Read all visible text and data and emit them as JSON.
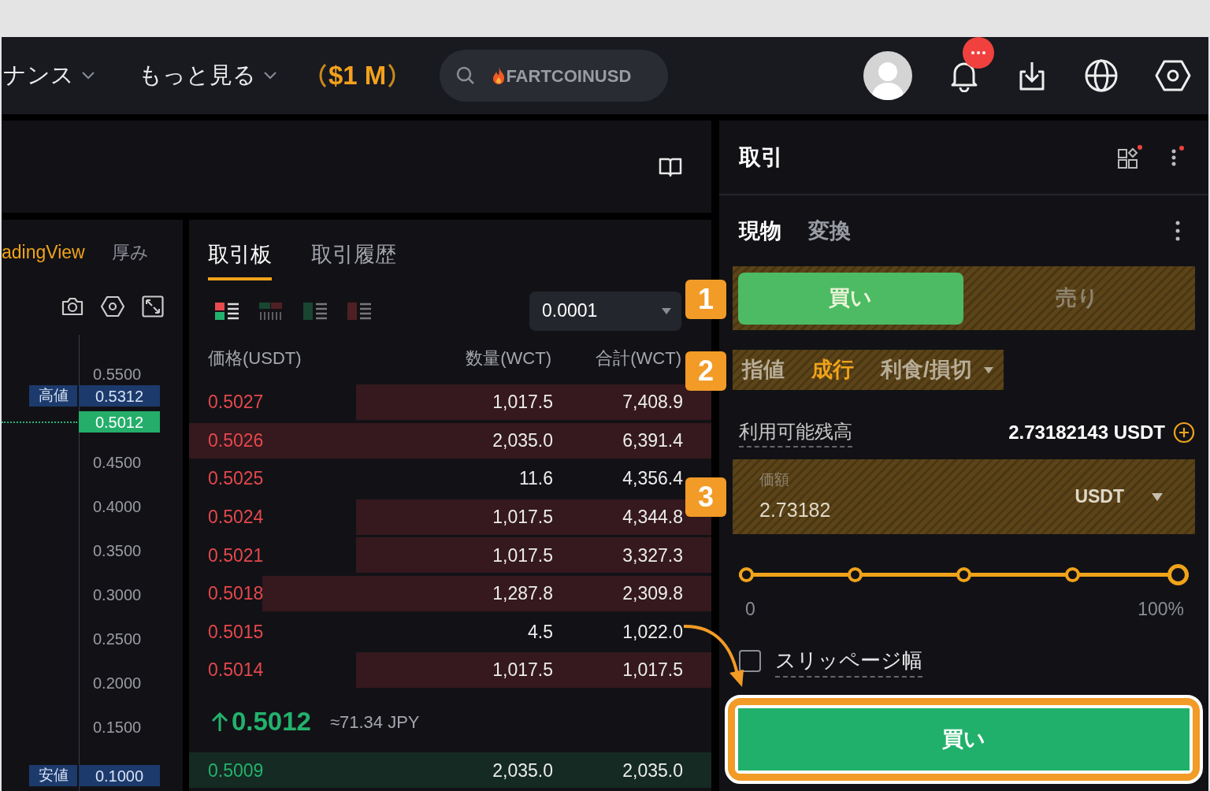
{
  "nav": {
    "menu": [
      {
        "label": "ナンス"
      },
      {
        "label": "もっと見る"
      }
    ],
    "promo": "$1 M",
    "search": {
      "placeholder": "FARTCOINUSD"
    }
  },
  "chart": {
    "tabs": [
      {
        "label": "adingView",
        "selected": true
      },
      {
        "label": "厚み",
        "selected": false
      }
    ],
    "axis_ticks": [
      "0.5500",
      "0.4500",
      "0.4000",
      "0.3500",
      "0.3000",
      "0.2500",
      "0.2000",
      "0.1500"
    ],
    "high": {
      "label": "高値",
      "value": "0.5312"
    },
    "current": "0.5012",
    "low": {
      "label": "安値",
      "value": "0.1000"
    }
  },
  "order_book": {
    "tabs": [
      {
        "label": "取引板",
        "selected": true
      },
      {
        "label": "取引履歴",
        "selected": false
      }
    ],
    "views": [
      {
        "kind": "both",
        "selected": true
      },
      {
        "kind": "depth",
        "selected": false
      },
      {
        "kind": "bids",
        "selected": false
      },
      {
        "kind": "asks",
        "selected": false
      }
    ],
    "tick_size": "0.0001",
    "columns": [
      "価格(USDT)",
      "数量(WCT)",
      "合計(WCT)"
    ],
    "asks": [
      {
        "price": "0.5027",
        "amount": "1,017.5",
        "total": "7,408.9",
        "level": 0.68
      },
      {
        "price": "0.5026",
        "amount": "2,035.0",
        "total": "6,391.4",
        "level": 1
      },
      {
        "price": "0.5025",
        "amount": "11.6",
        "total": "4,356.4",
        "level": 0
      },
      {
        "price": "0.5024",
        "amount": "1,017.5",
        "total": "4,344.8",
        "level": 0.68
      },
      {
        "price": "0.5021",
        "amount": "1,017.5",
        "total": "3,327.3",
        "level": 0.68
      },
      {
        "price": "0.5018",
        "amount": "1,287.8",
        "total": "2,309.8",
        "level": 0.86
      },
      {
        "price": "0.5015",
        "amount": "4.5",
        "total": "1,022.0",
        "level": 0
      },
      {
        "price": "0.5014",
        "amount": "1,017.5",
        "total": "1,017.5",
        "level": 0.68
      }
    ],
    "last_price": "0.5012",
    "last_price_fiat": "≈71.34 JPY",
    "bids": [
      {
        "price": "0.5009",
        "amount": "2,035.0",
        "total": "2,035.0",
        "level": 1
      }
    ]
  },
  "trade_panel": {
    "title": "取引",
    "tabs": [
      {
        "label": "現物",
        "selected": true
      },
      {
        "label": "変換",
        "selected": false
      }
    ],
    "sides": [
      {
        "label": "買い",
        "selected": true
      },
      {
        "label": "売り",
        "selected": false
      }
    ],
    "order_types": [
      {
        "label": "指値",
        "selected": false,
        "dropdown": false
      },
      {
        "label": "成行",
        "selected": true,
        "dropdown": false
      },
      {
        "label": "利食/損切",
        "selected": false,
        "dropdown": true
      }
    ],
    "balance": {
      "label": "利用可能残高",
      "value": "2.73182143 USDT"
    },
    "amount": {
      "label": "価額",
      "value": "2.73182",
      "unit": "USDT"
    },
    "slider": {
      "level": 1,
      "min_label": "0",
      "max_label": "100%"
    },
    "slippage": {
      "label": "スリッページ幅",
      "checked": false
    },
    "submit": "買い"
  },
  "annotations": [
    {
      "label": "1"
    },
    {
      "label": "2"
    },
    {
      "label": "3"
    }
  ]
}
